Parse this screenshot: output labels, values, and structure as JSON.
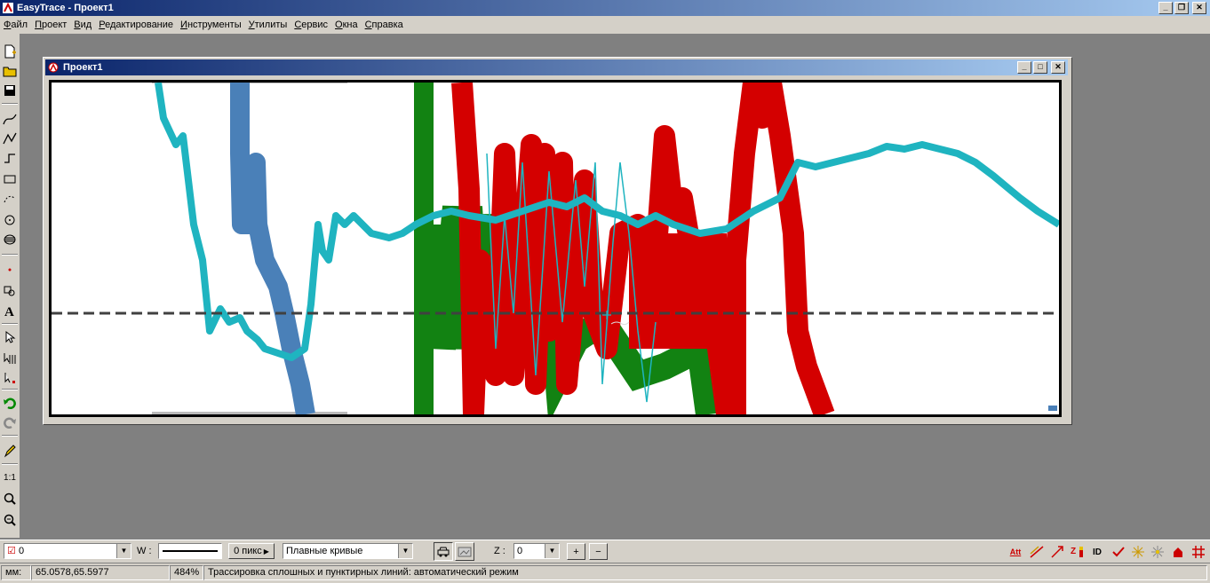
{
  "app": {
    "title": "EasyTrace - Проект1"
  },
  "menu": [
    "Файл",
    "Проект",
    "Вид",
    "Редактирование",
    "Инструменты",
    "Утилиты",
    "Сервис",
    "Окна",
    "Справка"
  ],
  "child_window": {
    "title": "Проект1"
  },
  "layer_box": {
    "value": "0"
  },
  "width_label": "W :",
  "pixel_button": "0 пикс",
  "curve_mode": {
    "value": "Плавные кривые"
  },
  "z_label": "Z :",
  "z_box": {
    "value": "0"
  },
  "zoom_plus": "+",
  "zoom_minus": "−",
  "scale_label": "1:1",
  "toolbar_right_labels": [
    "Att",
    "ID"
  ],
  "status": {
    "units": "мм:",
    "coords": "65.0578,65.5977",
    "zoom": "484%",
    "message": "Трассировка сплошных и пунктирных линий: автоматический режим"
  },
  "colors": {
    "title_start": "#0a246a",
    "title_end": "#a6caf0",
    "cyan_line": "#1fb4c0",
    "blue_line": "#4a80b8",
    "green_line": "#128212",
    "red_line": "#d40000",
    "dashed": "#404040"
  }
}
